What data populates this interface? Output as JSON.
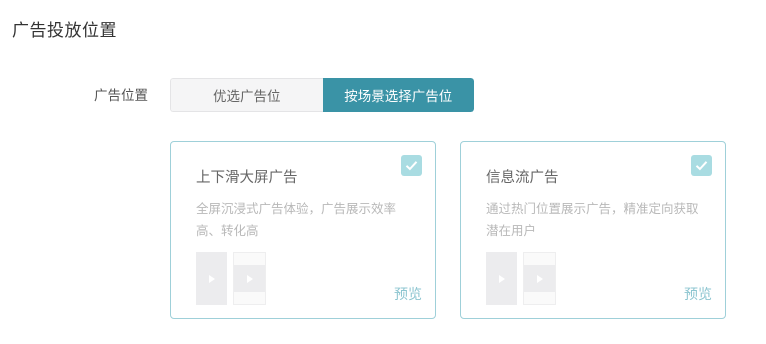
{
  "section": {
    "title": "广告投放位置"
  },
  "placement": {
    "label": "广告位置",
    "options": [
      {
        "label": "优选广告位",
        "selected": false
      },
      {
        "label": "按场景选择广告位",
        "selected": true
      }
    ]
  },
  "cards": [
    {
      "title": "上下滑大屏广告",
      "description": "全屏沉浸式广告体验，广告展示效率高、转化高",
      "checked": true,
      "preview_label": "预览"
    },
    {
      "title": "信息流广告",
      "description": "通过热门位置展示广告，精准定向获取潜在用户",
      "checked": true,
      "preview_label": "预览"
    }
  ],
  "colors": {
    "accent": "#3a93a6",
    "card_border": "#9fd0d9",
    "check_bg": "#a9dce2",
    "preview_link": "#8cc5d0"
  },
  "icons": {
    "check": "check-icon",
    "play": "play-icon"
  }
}
